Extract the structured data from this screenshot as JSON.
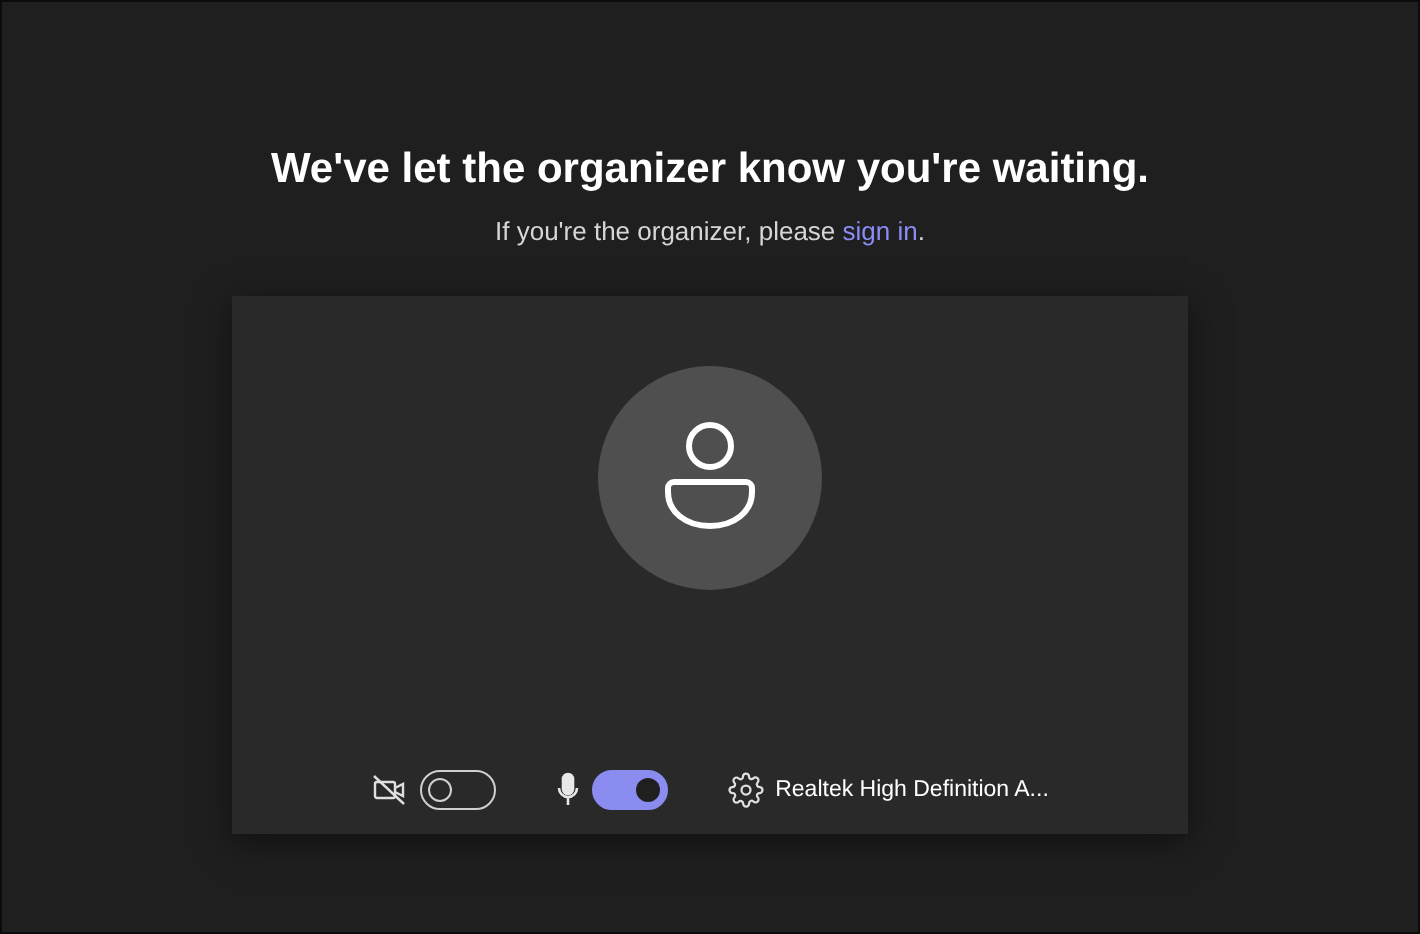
{
  "heading": "We've let the organizer know you're waiting.",
  "subtitle": {
    "before": "If you're the organizer, please ",
    "link": "sign in",
    "after": "."
  },
  "controls": [
    {
      "kind": "camera",
      "on": false
    },
    {
      "kind": "mic",
      "on": true
    }
  ],
  "device": {
    "label": "Realtek High Definition A..."
  }
}
